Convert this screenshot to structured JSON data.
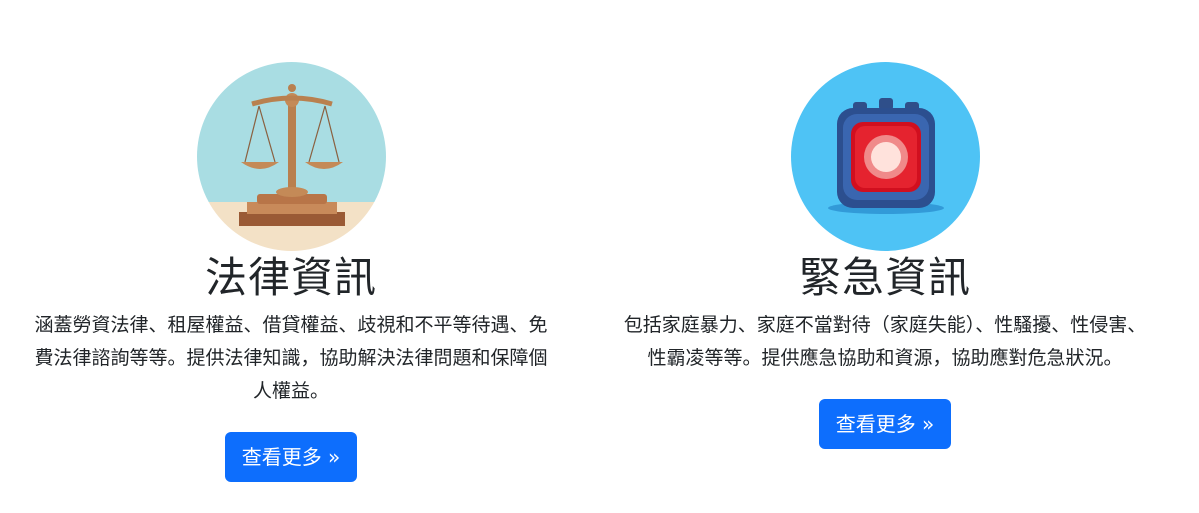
{
  "cards": [
    {
      "title": "法律資訊",
      "description": "涵蓋勞資法律、租屋權益、借貸權益、歧視和不平等待遇、免費法律諮詢等等。提供法律知識，協助解決法律問題和保障個人權益。",
      "button_label": "查看更多 »",
      "image_icon": "scales-of-justice-icon",
      "accent": "#bfe7ee"
    },
    {
      "title": "緊急資訊",
      "description": "包括家庭暴力、家庭不當對待（家庭失能）、性騷擾、性侵害、性霸凌等等。提供應急協助和資源，協助應對危急狀況。",
      "button_label": "查看更多 »",
      "image_icon": "emergency-alarm-icon",
      "accent": "#4ec3f5"
    }
  ],
  "colors": {
    "button_bg": "#0d6efd",
    "button_text": "#ffffff",
    "text": "#212529"
  }
}
